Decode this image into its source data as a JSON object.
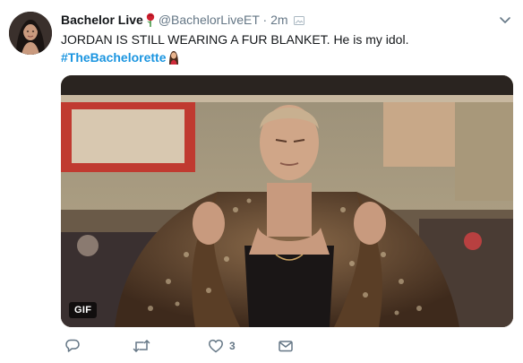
{
  "tweet": {
    "display_name": "Bachelor Live",
    "handle": "@BachelorLiveET",
    "separator": "·",
    "time": "2m",
    "text": "JORDAN IS STILL WEARING A FUR BLANKET. He is my idol.",
    "hashtag": "#TheBachelorette",
    "media_badge": "GIF",
    "actions": {
      "reply_count": "",
      "retweet_count": "",
      "like_count": "3"
    }
  },
  "icons": {
    "name_badge": "rose-icon",
    "time_badge": "media-icon",
    "hashtag_badge": "woman-emoji-icon",
    "menu": "chevron-down-icon",
    "reply": "reply-icon",
    "retweet": "retweet-icon",
    "like": "heart-icon",
    "dm": "envelope-icon"
  },
  "colors": {
    "text": "#14171a",
    "secondary": "#657786",
    "link": "#1b95e0"
  }
}
